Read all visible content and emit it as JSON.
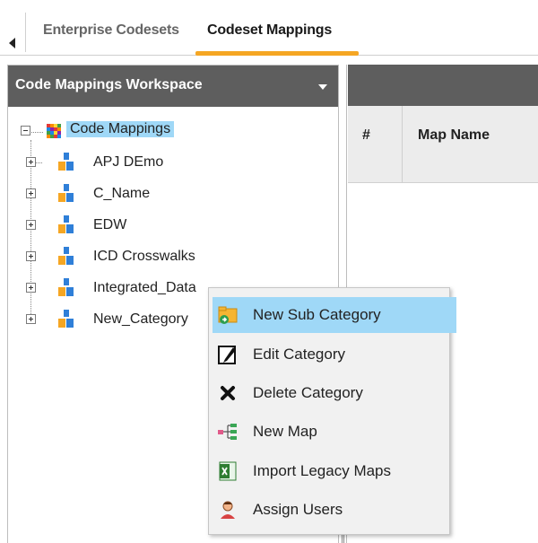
{
  "tabs": {
    "inactive_label": "Enterprise Codesets",
    "active_label": "Codeset Mappings"
  },
  "workspace": {
    "title": "Code Mappings Workspace"
  },
  "tree": {
    "root_label": "Code Mappings",
    "nodes": [
      "APJ DEmo",
      "C_Name",
      "EDW",
      "ICD Crosswalks",
      "Integrated_Data",
      "New_Category"
    ]
  },
  "grid": {
    "col_index": "#",
    "col_map_name": "Map Name"
  },
  "context_menu": {
    "items": [
      {
        "label": "New Sub Category",
        "icon": "new-sub-category-icon",
        "highlighted": true
      },
      {
        "label": "Edit Category",
        "icon": "pencil-icon"
      },
      {
        "label": "Delete Category",
        "icon": "delete-x-icon"
      },
      {
        "label": "New Map",
        "icon": "new-map-icon"
      },
      {
        "label": "Import Legacy Maps",
        "icon": "excel-import-icon"
      },
      {
        "label": "Assign Users",
        "icon": "user-icon"
      }
    ]
  },
  "colors": {
    "accent": "#f5a623",
    "header": "#5e5e5e",
    "selection": "#9fd8f7",
    "category_blue": "#2f7fd8"
  }
}
